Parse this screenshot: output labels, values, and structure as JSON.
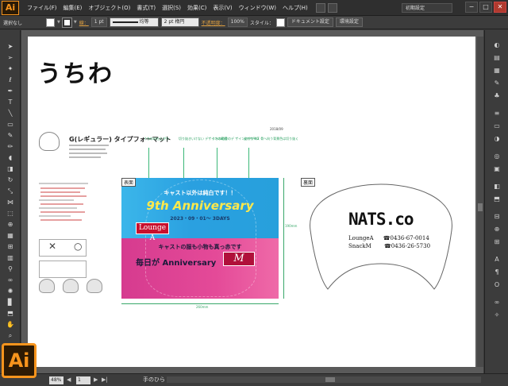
{
  "app": {
    "logo": "Ai",
    "menu": [
      "ファイル(F)",
      "編集(E)",
      "オブジェクト(O)",
      "書式(T)",
      "選択(S)",
      "効果(C)",
      "表示(V)",
      "ウィンドウ(W)",
      "ヘルプ(H)"
    ],
    "workspace": "初期設定",
    "window_buttons": [
      "−",
      "□",
      "✕"
    ]
  },
  "controlbar": {
    "selection": "選択なし",
    "stroke_label": "線：",
    "stroke_weight": "1 pt",
    "profile": "均等",
    "brush": "2 pt 楕円",
    "opacity_label": "不透明度：",
    "opacity_value": "100%",
    "style_label": "スタイル：",
    "doc_setup": "ドキュメント設定",
    "prefs": "環境設定"
  },
  "document": {
    "heading": "うちわ",
    "spec_title": "G(レギュラー) タイプフォーマット",
    "date_code": "2018/09",
    "callouts": [
      "うちわの仕上がり",
      "切り抜きいけない デザインの範囲",
      "うちわの骨のデ ザインの中がNG",
      "塗りサイズ 骨へ向う背景色は切り抜く"
    ],
    "front": {
      "label": "表面",
      "line1": "キャスト以外は純白です！！",
      "anniversary": "9th Anniversary",
      "date": "2023・09・01〜 3DAYS",
      "lounge": "Lounge A",
      "line2": "キャストの服も小物も真っ赤です",
      "line3": "毎日が Anniversary",
      "snack": "M"
    },
    "back": {
      "label": "裏面",
      "brand": "NATS.co",
      "rows": [
        {
          "name": "LoungeA",
          "phone": "☎0436-67-0014"
        },
        {
          "name": "SnackM",
          "phone": "☎0436-26-5730"
        }
      ]
    },
    "dim_front_width": "260mm",
    "dim_front_height": "190mm"
  },
  "status": {
    "zoom": "48%",
    "page": "1",
    "tool_hint": "手のひら"
  }
}
